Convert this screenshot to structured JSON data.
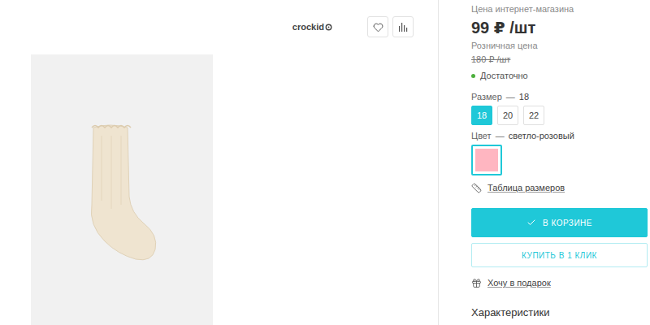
{
  "brand": {
    "logo": "crockid"
  },
  "price": {
    "label": "Цена интернет-магазина",
    "value": "99 ₽ /шт"
  },
  "retail": {
    "label": "Розничная цена",
    "value": "180 ₽ /шт"
  },
  "stock": {
    "text": "Достаточно"
  },
  "size": {
    "label": "Размер",
    "separator": "—",
    "value": "18",
    "options": [
      {
        "label": "18",
        "selected": true
      },
      {
        "label": "20",
        "selected": false
      },
      {
        "label": "22",
        "selected": false
      }
    ]
  },
  "color": {
    "label": "Цвет",
    "separator": "—",
    "value": "светло-розовый",
    "swatches": [
      {
        "color": "#ffb6c1",
        "selected": true
      }
    ]
  },
  "size_table": "Таблица размеров",
  "buttons": [
    {
      "label": "В КОРЗИНЕ",
      "kind": "primary"
    },
    {
      "label": "КУПИТЬ В 1 КЛИК",
      "kind": "outline"
    }
  ],
  "gift": "Хочу в подарок",
  "section": "Характеристики"
}
